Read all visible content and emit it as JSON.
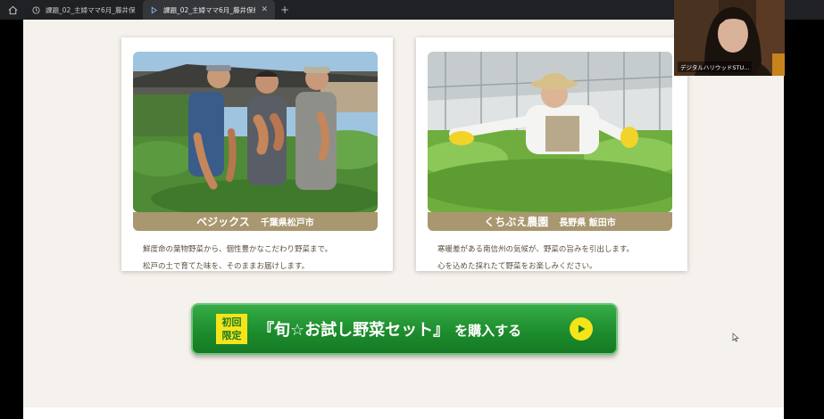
{
  "browser": {
    "tabs": [
      {
        "label": "課題_02_主婦ママ6月_藤井保紳",
        "active": false
      },
      {
        "label": "課題_02_主婦ママ6月_藤井保紳 - ",
        "active": true
      }
    ]
  },
  "farms": [
    {
      "name": "ベジックス",
      "location": "千葉県松戸市",
      "description": [
        "鮮度命の葉物野菜から、個性豊かなこだわり野菜まで。",
        "松戸の土で育てた味を、そのままお届けします。"
      ]
    },
    {
      "name": "くちぶえ農園",
      "location": "長野県 飯田市",
      "description": [
        "寒暖差がある南信州の気候が、野菜の旨みを引出します。",
        "心を込めた採れたて野菜をお楽しみください。"
      ]
    }
  ],
  "cta": {
    "badge_line1": "初回",
    "badge_line2": "限定",
    "label": "『旬☆お試し野菜セット』",
    "suffix": "を購入する"
  },
  "webcam": {
    "participant_name": "デジタルハリウッドSTU..."
  },
  "colors": {
    "page_bg": "#f5f1ec",
    "banner": "#a99770",
    "cta_green": "#1c8a2c",
    "badge_yellow": "#f5e41a"
  }
}
